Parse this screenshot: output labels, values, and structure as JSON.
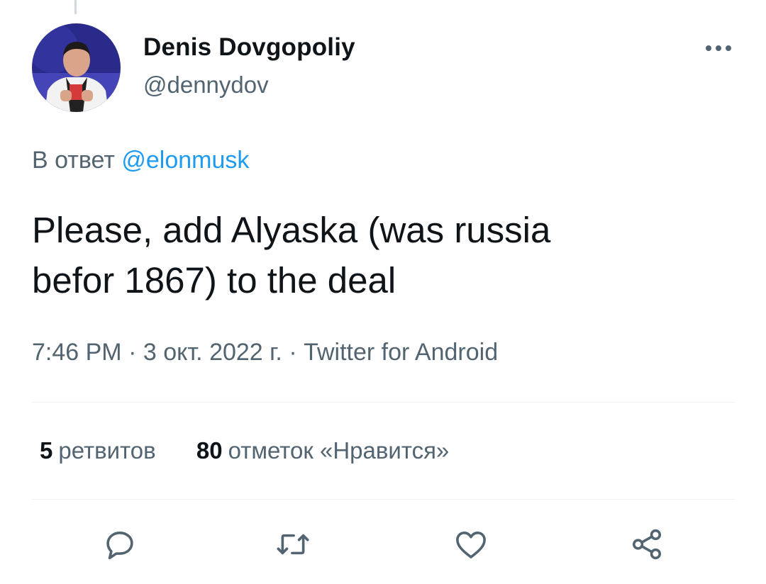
{
  "tweet": {
    "author": {
      "display_name": "Denis Dovgopoliy",
      "handle": "@dennydov",
      "avatar_icon": "user-avatar-photo"
    },
    "more_icon": "more-dots-icon",
    "reply_to": {
      "prefix": "В ответ",
      "mention": "@elonmusk"
    },
    "text": "Please, add Alyaska (was russia\nbefor 1867) to the deal",
    "meta": {
      "time": "7:46 PM",
      "separator": "·",
      "date": "3 окт. 2022 г.",
      "source": "Twitter for Android"
    },
    "stats": {
      "retweets_count": "5",
      "retweets_label": "ретвитов",
      "likes_count": "80",
      "likes_label": "отметок «Нравится»"
    },
    "actions": {
      "reply_icon": "reply-bubble-icon",
      "retweet_icon": "retweet-arrows-icon",
      "like_icon": "heart-icon",
      "share_icon": "share-nodes-icon"
    }
  },
  "colors": {
    "text_primary": "#0f1419",
    "text_secondary": "#536471",
    "link_blue": "#1d9bf0",
    "divider": "#eff3f4"
  }
}
